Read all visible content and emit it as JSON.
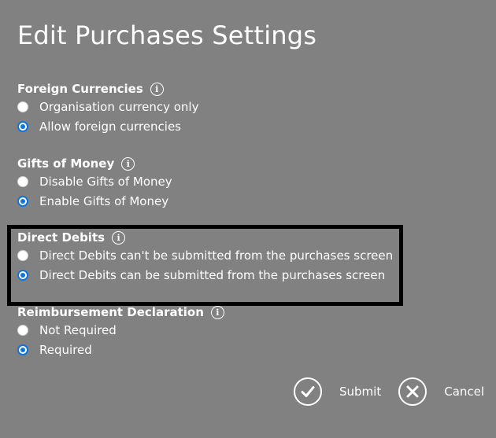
{
  "page": {
    "title": "Edit Purchases Settings"
  },
  "sections": [
    {
      "label": "Foreign Currencies",
      "info_icon": "info-icon",
      "options": [
        {
          "label": "Organisation currency only",
          "checked": false
        },
        {
          "label": "Allow foreign currencies",
          "checked": true
        }
      ]
    },
    {
      "label": "Gifts of Money",
      "info_icon": "info-icon",
      "options": [
        {
          "label": "Disable Gifts of Money",
          "checked": false
        },
        {
          "label": "Enable Gifts of Money",
          "checked": true
        }
      ]
    },
    {
      "label": "Direct Debits",
      "info_icon": "info-icon",
      "options": [
        {
          "label": "Direct Debits can't be submitted from the purchases screen",
          "checked": false
        },
        {
          "label": "Direct Debits can be submitted from the purchases screen",
          "checked": true
        }
      ]
    },
    {
      "label": "Reimbursement Declaration",
      "info_icon": "info-icon",
      "options": [
        {
          "label": "Not Required",
          "checked": false
        },
        {
          "label": "Required",
          "checked": true
        }
      ]
    }
  ],
  "info_glyph": "i",
  "actions": {
    "submit_label": "Submit",
    "submit_icon": "check-circle-icon",
    "cancel_label": "Cancel",
    "cancel_icon": "close-circle-icon"
  },
  "colors": {
    "background": "#818181",
    "text": "#ffffff",
    "radio_selected": "#0b74de",
    "highlight_border": "#000000"
  }
}
